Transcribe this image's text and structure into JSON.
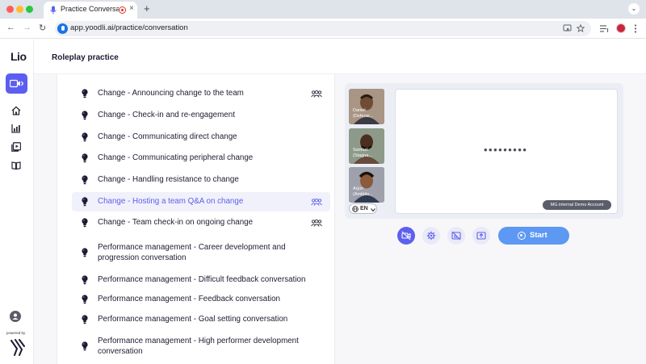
{
  "browser": {
    "tab_title": "Practice Conversation - Y",
    "tab_close": "×",
    "new_tab": "+",
    "url": "app.yoodli.ai/practice/conversation",
    "tab_menu": "⌄",
    "back": "←",
    "forward": "→",
    "reload": "↻"
  },
  "app": {
    "logo": "Lio",
    "page_title": "Roleplay practice",
    "powered_by": "powered by",
    "accent": "#5d60ee"
  },
  "scenarios": [
    {
      "label": "Change - Announcing change to the team",
      "team": true,
      "active": false
    },
    {
      "label": "Change - Check-in and re-engagement",
      "team": false,
      "active": false
    },
    {
      "label": "Change - Communicating direct change",
      "team": false,
      "active": false
    },
    {
      "label": "Change - Communicating peripheral change",
      "team": false,
      "active": false
    },
    {
      "label": "Change - Handling resistance to change",
      "team": false,
      "active": false
    },
    {
      "label": "Change - Hosting a team Q&A on change",
      "team": true,
      "active": true
    },
    {
      "label": "Change - Team check-in on ongoing change",
      "team": true,
      "active": false
    },
    {
      "label": "Performance management - Career development and progression conversation",
      "team": false,
      "active": false
    },
    {
      "label": "Performance management - Difficult feedback conversation",
      "team": false,
      "active": false
    },
    {
      "label": "Performance management - Feedback conversation",
      "team": false,
      "active": false
    },
    {
      "label": "Performance management - Goal setting conversation",
      "team": false,
      "active": false
    },
    {
      "label": "Performance management - High performer development conversation",
      "team": false,
      "active": false
    }
  ],
  "participants": [
    {
      "name": "Daniel",
      "role": "(Defensi..."
    },
    {
      "name": "Samuel",
      "role": "(Stagna..."
    },
    {
      "name": "Arjun",
      "role": "(Ambitio..."
    }
  ],
  "video": {
    "loading_dots": "•••••••••",
    "account_badge": "MG internal Demo Account",
    "language": "EN"
  },
  "controls": {
    "start_label": "Start"
  }
}
